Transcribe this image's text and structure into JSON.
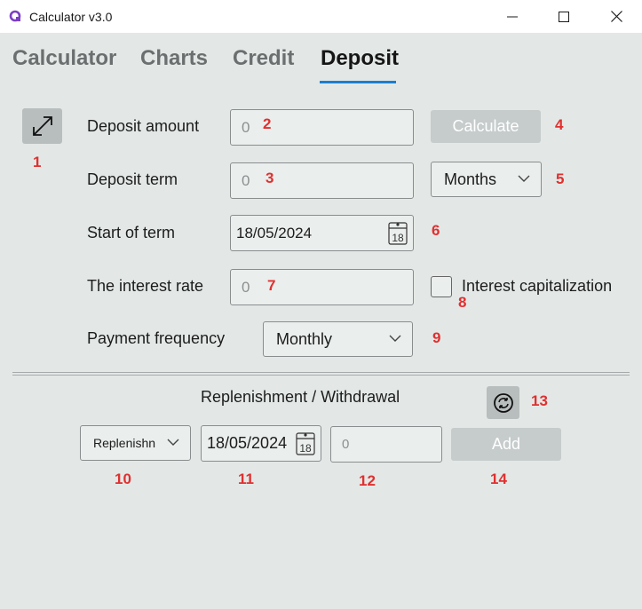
{
  "window": {
    "title": "Calculator v3.0",
    "accent": "#7b3fc4",
    "minimize_icon": "minimize-icon",
    "maximize_icon": "maximize-icon",
    "close_icon": "close-icon"
  },
  "tabs": [
    {
      "label": "Calculator",
      "active": false
    },
    {
      "label": "Charts",
      "active": false
    },
    {
      "label": "Credit",
      "active": false
    },
    {
      "label": "Deposit",
      "active": true
    }
  ],
  "tab_underline_color": "#1c7fcf",
  "deposit": {
    "amount_label": "Deposit amount",
    "amount_placeholder": "0",
    "term_label": "Deposit term",
    "term_placeholder": "0",
    "term_unit": "Months",
    "start_label": "Start of term",
    "start_value": "18/05/2024",
    "rate_label": "The interest rate",
    "rate_placeholder": "0",
    "capitalization_label": "Interest capitalization",
    "capitalization_checked": false,
    "frequency_label": "Payment frequency",
    "frequency_value": "Monthly",
    "calculate_label": "Calculate"
  },
  "replenishment": {
    "heading": "Replenishment / Withdrawal",
    "type_value": "Replenishn",
    "date_value": "18/05/2024",
    "amount_placeholder": "0",
    "add_label": "Add"
  },
  "calendar_day": "18",
  "badges": [
    "1",
    "2",
    "3",
    "4",
    "5",
    "6",
    "7",
    "8",
    "9",
    "10",
    "11",
    "12",
    "13",
    "14"
  ],
  "badge_color": "#e03030"
}
